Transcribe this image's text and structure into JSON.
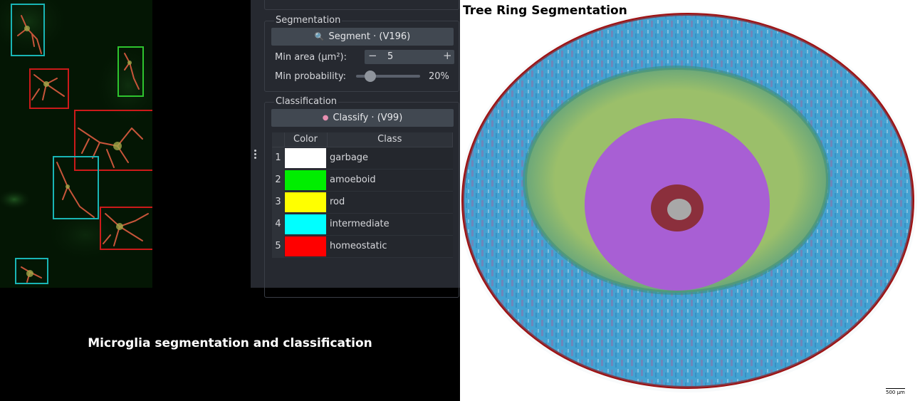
{
  "left_panel": {
    "caption": "Microglia segmentation and classification",
    "boxes_colors": {
      "intermediate": "#19b5b5",
      "amoeboid": "#2ec42e",
      "homeostatic": "#cc1a1a"
    }
  },
  "widget": {
    "segmentation": {
      "title": "Segmentation",
      "segment_button_icon": "search-icon",
      "segment_button": "Segment · (V196)",
      "min_area_label": "Min area (µm²):",
      "min_area_value": "5",
      "minus": "−",
      "plus": "+",
      "min_prob_label": "Min probability:",
      "min_prob_value": "20%",
      "min_prob_fraction": 0.2
    },
    "classification": {
      "title": "Classification",
      "classify_button_icon": "brain-icon",
      "classify_button": "Classify · (V99)",
      "table": {
        "headers": [
          "Color",
          "Class"
        ],
        "rows": [
          {
            "index": "1",
            "color": "#ffffff",
            "name": "garbage"
          },
          {
            "index": "2",
            "color": "#00ee00",
            "name": "amoeboid"
          },
          {
            "index": "3",
            "color": "#ffff00",
            "name": "rod"
          },
          {
            "index": "4",
            "color": "#00ffff",
            "name": "intermediate"
          },
          {
            "index": "5",
            "color": "#ff0000",
            "name": "homeostatic"
          }
        ]
      }
    }
  },
  "right_panel": {
    "title": "Tree Ring Segmentation",
    "scale_bar": "500 µm",
    "ring_colors": {
      "outer_line": "#a01010",
      "bark": "#3a9acb",
      "sapwood": "#9bbf6a",
      "heartwood": "#a85fd4",
      "pith": "#8b2f3c",
      "pith_center": "#a8a8a8"
    }
  }
}
